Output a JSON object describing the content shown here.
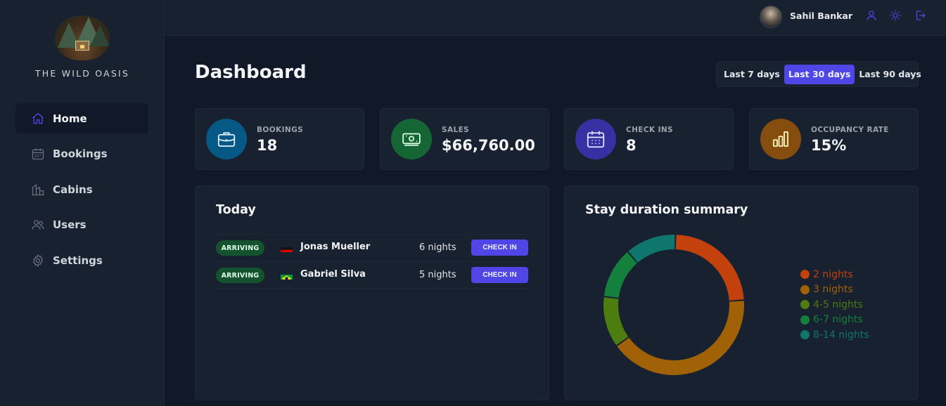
{
  "brand": {
    "name": "THE WILD OASIS"
  },
  "sidebar": {
    "items": [
      {
        "label": "Home",
        "icon": "home-icon",
        "active": true
      },
      {
        "label": "Bookings",
        "icon": "calendar-icon"
      },
      {
        "label": "Cabins",
        "icon": "cabin-icon"
      },
      {
        "label": "Users",
        "icon": "users-icon"
      },
      {
        "label": "Settings",
        "icon": "gear-icon"
      }
    ]
  },
  "header": {
    "user_name": "Sahil Bankar",
    "actions": [
      "user-icon",
      "sun-icon",
      "logout-icon"
    ]
  },
  "page": {
    "title": "Dashboard"
  },
  "filter": {
    "options": [
      "Last 7 days",
      "Last 30 days",
      "Last 90 days"
    ],
    "selected": "Last 30 days"
  },
  "stats": [
    {
      "label": "BOOKINGS",
      "value": "18",
      "icon": "briefcase-icon",
      "color": "#075985",
      "icon_color": "#e0f2fe"
    },
    {
      "label": "SALES",
      "value": "$66,760.00",
      "icon": "banknotes-icon",
      "color": "#166534",
      "icon_color": "#dcfce7"
    },
    {
      "label": "CHECK INS",
      "value": "8",
      "icon": "calendar-days-icon",
      "color": "#3730a3",
      "icon_color": "#e0e7ff"
    },
    {
      "label": "OCCUPANCY RATE",
      "value": "15%",
      "icon": "chart-bar-icon",
      "color": "#854d0e",
      "icon_color": "#fef9c3"
    }
  ],
  "today": {
    "title": "Today",
    "rows": [
      {
        "status": "ARRIVING",
        "flag": "de",
        "guest": "Jonas Mueller",
        "nights": "6 nights",
        "action": "CHECK IN"
      },
      {
        "status": "ARRIVING",
        "flag": "br",
        "guest": "Gabriel Silva",
        "nights": "5 nights",
        "action": "CHECK IN"
      }
    ]
  },
  "stay_summary": {
    "title": "Stay duration summary"
  },
  "chart_data": {
    "type": "pie",
    "title": "Stay duration summary",
    "categories": [
      "2 nights",
      "3 nights",
      "4-5 nights",
      "6-7 nights",
      "8-14 nights"
    ],
    "values": [
      4,
      7,
      2,
      2,
      2
    ],
    "colors": [
      "#c2410c",
      "#a16207",
      "#4d7c0f",
      "#15803d",
      "#0f766e"
    ],
    "legend_position": "right"
  }
}
